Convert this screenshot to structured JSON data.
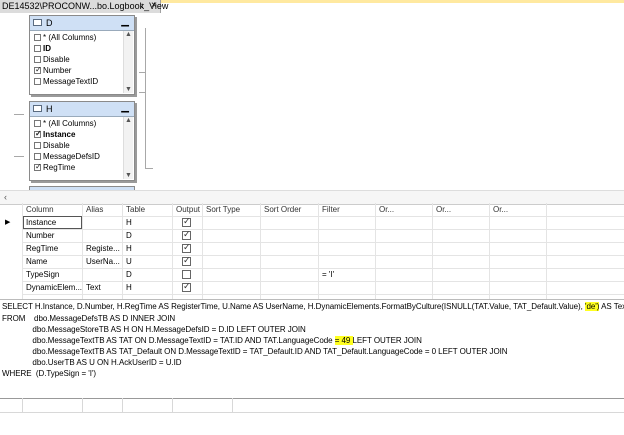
{
  "tab": {
    "title": "DE14532\\PROCONW...bo.Logbook_View",
    "pin": "↕",
    "close": "×"
  },
  "diagram": {
    "tables": [
      {
        "name": "D",
        "columns": [
          {
            "label": "* (All Columns)",
            "checked": false
          },
          {
            "label": "ID",
            "checked": false
          },
          {
            "label": "Disable",
            "checked": false
          },
          {
            "label": "Number",
            "checked": true
          },
          {
            "label": "MessageTextID",
            "checked": false
          }
        ]
      },
      {
        "name": "H",
        "columns": [
          {
            "label": "* (All Columns)",
            "checked": false
          },
          {
            "label": "Instance",
            "checked": true
          },
          {
            "label": "Disable",
            "checked": false
          },
          {
            "label": "MessageDefsID",
            "checked": false
          },
          {
            "label": "RegTime",
            "checked": true
          }
        ]
      }
    ],
    "minimize_symbol": "▁"
  },
  "grid": {
    "headers": [
      "Column",
      "Alias",
      "Table",
      "Output",
      "Sort Type",
      "Sort Order",
      "Filter",
      "Or...",
      "Or...",
      "Or..."
    ],
    "rows": [
      {
        "column": "Instance",
        "alias": "",
        "table": "H",
        "output": true,
        "filter": ""
      },
      {
        "column": "Number",
        "alias": "",
        "table": "D",
        "output": true,
        "filter": ""
      },
      {
        "column": "RegTime",
        "alias": "Registe...",
        "table": "H",
        "output": true,
        "filter": ""
      },
      {
        "column": "Name",
        "alias": "UserNa...",
        "table": "U",
        "output": true,
        "filter": ""
      },
      {
        "column": "TypeSign",
        "alias": "",
        "table": "D",
        "output": false,
        "filter": "= 'I'"
      },
      {
        "column": "DynamicElem...",
        "alias": "Text",
        "table": "H",
        "output": true,
        "filter": ""
      }
    ]
  },
  "sql": {
    "line1_a": "SELECT H.Instance, D.Number, H.RegTime AS RegisterTime, U.Name AS UserName, H.DynamicElements.FormatByCulture(ISNULL(TAT.Value, TAT_Default.Value), ",
    "line1_hl": "'de')",
    "line1_b": " AS Text",
    "line2": "FROM    dbo.MessageDefsTB AS D INNER JOIN",
    "line3": "              dbo.MessageStoreTB AS H ON H.MessageDefsID = D.ID LEFT OUTER JOIN",
    "line4_a": "              dbo.MessageTextTB AS TAT ON D.MessageTextID = TAT.ID AND TAT.LanguageCode ",
    "line4_hl": "= 49 ",
    "line4_b": "LEFT OUTER JOIN",
    "line5": "              dbo.MessageTextTB AS TAT_Default ON D.MessageTextID = TAT_Default.ID AND TAT_Default.LanguageCode = 0 LEFT OUTER JOIN",
    "line6": "              dbo.UserTB AS U ON H.AckUserID = U.ID",
    "line7": "WHERE  (D.TypeSign = 'I')"
  }
}
